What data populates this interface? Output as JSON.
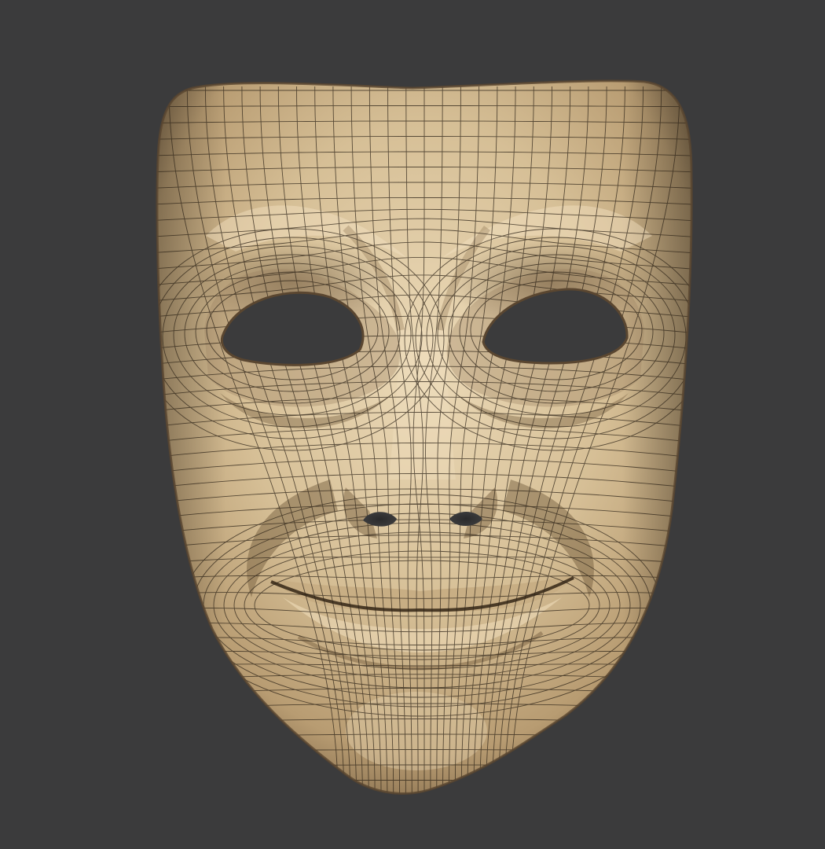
{
  "scene": {
    "subject": "mask-model",
    "background_color": "#3b3b3c",
    "surface_color": "#d6bf96",
    "surface_highlight": "#ecdab8",
    "surface_shadow": "#8f7654",
    "wire_color": "#2e2418",
    "hole_color": "#3b3b3c"
  }
}
